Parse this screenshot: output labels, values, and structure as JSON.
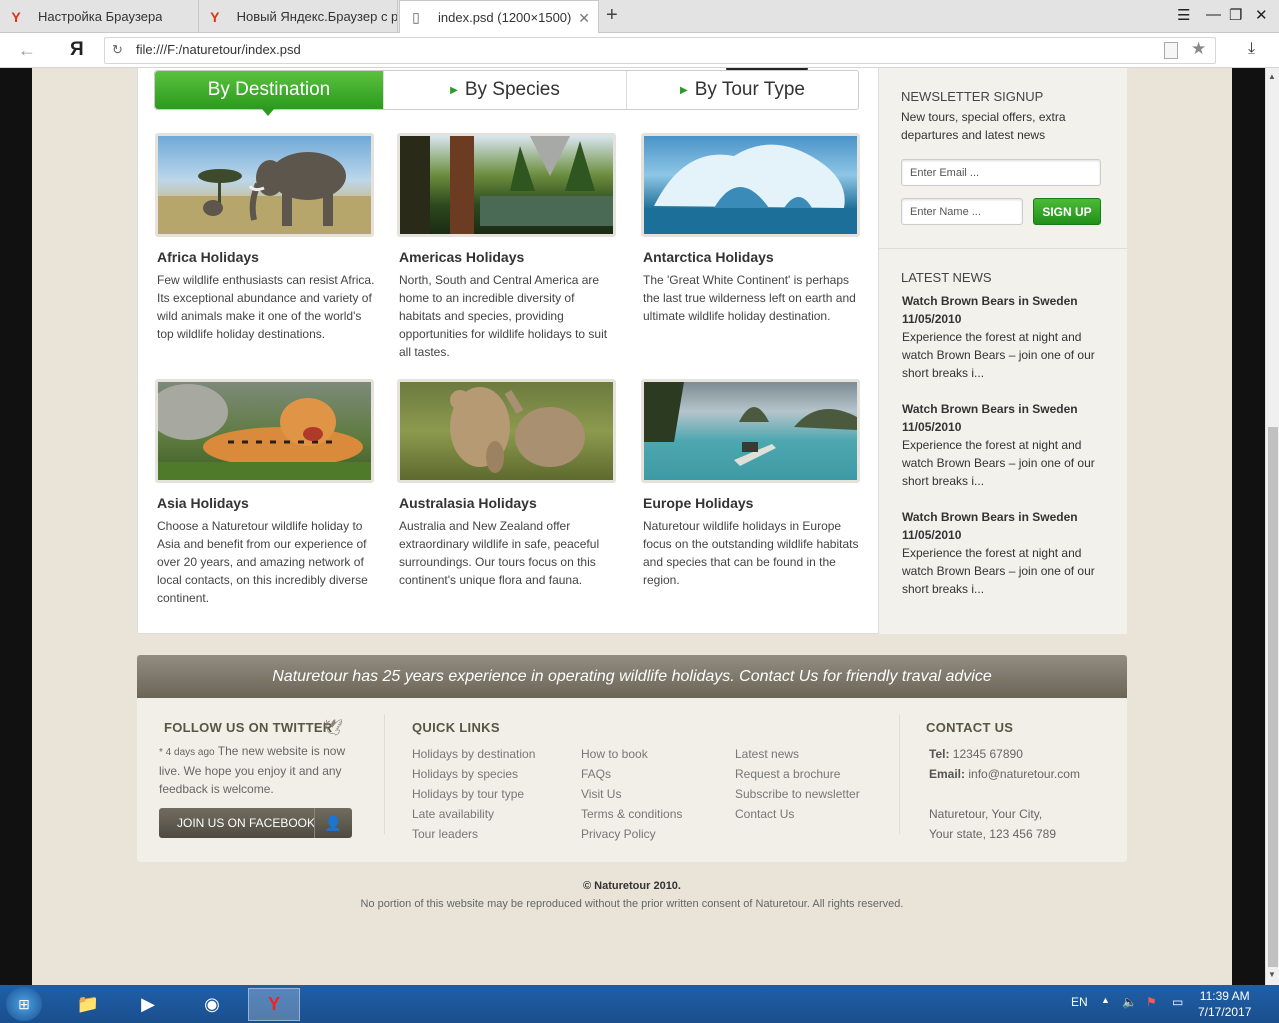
{
  "browser": {
    "tabs": [
      {
        "title": "Настройка Браузера",
        "icon": "yandex-icon"
      },
      {
        "title": "Новый Яндекс.Браузер с ре",
        "icon": "yandex-icon"
      },
      {
        "title": "index.psd (1200×1500)",
        "icon": "document-icon"
      }
    ],
    "logo": "Я",
    "url": "file:///F:/naturetour/index.psd"
  },
  "tabs_nav": [
    "By Destination",
    "By Species",
    "By Tour Type"
  ],
  "destinations": [
    {
      "title": "Africa Holidays",
      "text": "Few wildlife enthusiasts can resist Africa. Its exceptional abundance and variety of wild animals make it one of the world's top wildlife holiday destinations."
    },
    {
      "title": "Americas Holidays",
      "text": "North, South and Central America are home to an incredible diversity of habitats and species, providing opportunities for wildlife holidays to suit all tastes."
    },
    {
      "title": "Antarctica Holidays",
      "text": "The 'Great White Continent' is perhaps the last true wilderness left on earth and ultimate wildlife holiday destination."
    },
    {
      "title": "Asia Holidays",
      "text": "Choose a Naturetour wildlife holiday to Asia and benefit from our experience of over 20 years, and amazing network of local contacts, on this incredibly diverse continent."
    },
    {
      "title": "Australasia Holidays",
      "text": "Australia and New Zealand offer extraordinary wildlife in safe, peaceful surroundings. Our tours focus on this continent's unique flora and fauna."
    },
    {
      "title": "Europe Holidays",
      "text": "Naturetour wildlife holidays in Europe focus on the outstanding wildlife habitats and species that can be found in the region."
    }
  ],
  "newsletter": {
    "heading": "NEWSLETTER SIGNUP",
    "text": "New tours, special offers, extra departures and latest news",
    "email_placeholder": "Enter Email ...",
    "name_placeholder": "Enter Name ...",
    "button": "SIGN UP"
  },
  "latest_news": {
    "heading": "LATEST NEWS",
    "items": [
      {
        "title": "Watch Brown Bears in Sweden",
        "date": "11/05/2010",
        "text": "Experience the forest at night and watch Brown Bears – join one of our short breaks i..."
      },
      {
        "title": "Watch Brown Bears in Sweden",
        "date": "11/05/2010",
        "text": "Experience the forest at night and watch Brown Bears – join one of our short breaks i..."
      },
      {
        "title": "Watch Brown Bears in Sweden",
        "date": "11/05/2010",
        "text": "Experience the forest at night and watch Brown Bears – join one of our short breaks i..."
      }
    ]
  },
  "banner": "Naturetour has 25 years experience in operating wildlife holidays.  Contact Us for friendly traval advice",
  "footer": {
    "twitter_heading": "FOLLOW US ON TWITTER",
    "tweet_time": "* 4 days ago",
    "tweet_text": "The new website is now live. We hope you enjoy it and any feedback is welcome.",
    "facebook_button": "JOIN US ON FACEBOOK",
    "quick_links_heading": "QUICK LINKS",
    "links_col1": [
      "Holidays by destination",
      "Holidays by species",
      "Holidays by tour type",
      "Late availability",
      "Tour leaders"
    ],
    "links_col2": [
      "How to book",
      "FAQs",
      "Visit Us",
      "Terms & conditions",
      "Privacy Policy"
    ],
    "links_col3": [
      "Latest news",
      "Request a brochure",
      "Subscribe to newsletter",
      "Contact Us"
    ],
    "contact_heading": "CONTACT US",
    "tel_label": "Tel:",
    "tel": "12345 67890",
    "email_label": "Email:",
    "email": "info@naturetour.com",
    "address1": "Naturetour, Your City,",
    "address2": "Your state, 123 456 789"
  },
  "copyright": "© Naturetour 2010.",
  "disclaimer": "No portion of this website may be reproduced without the prior written consent of Naturetour. All rights reserved.",
  "taskbar": {
    "lang": "EN",
    "time": "11:39 AM",
    "date": "7/17/2017"
  }
}
